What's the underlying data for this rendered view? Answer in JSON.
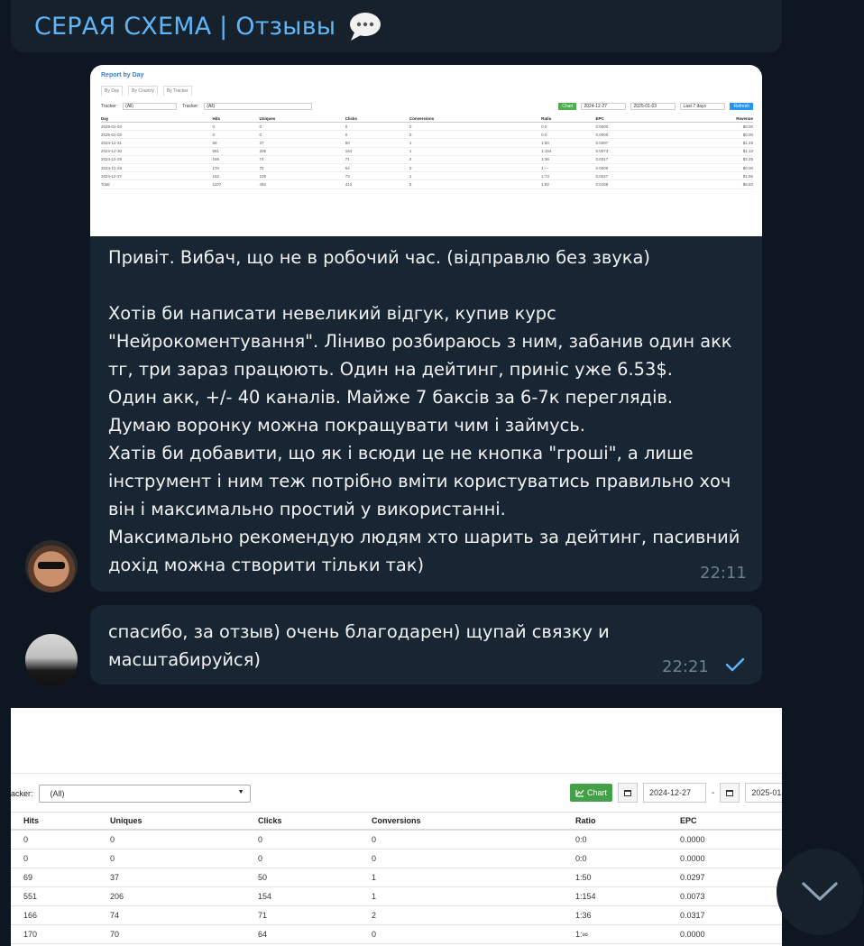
{
  "header": {
    "title": "СЕРАЯ СХЕМА | Отзывы",
    "title_icon": "speech-bubble-icon"
  },
  "report_thumb": {
    "title": "Report by Day",
    "tabs": [
      "By Day",
      "By Country",
      "By Tracker"
    ],
    "filter_label": "Tracker:",
    "filter_value": "(All)",
    "filter2_label": "Tracker:",
    "filter2_value": "(All)",
    "chart_label": "Chart",
    "date_from": "2024-12-27",
    "date_to": "2025-01-03",
    "range": "Last 7 days",
    "refresh_label": "Refresh",
    "columns": [
      "Day",
      "Hits",
      "Uniques",
      "Clicks",
      "Conversions",
      "Ratio",
      "EPC",
      "Revenue"
    ],
    "rows": [
      [
        "2025-01-03",
        "0",
        "0",
        "0",
        "0",
        "0.0",
        "0.0000",
        "$0.00"
      ],
      [
        "2025-01-02",
        "0",
        "0",
        "0",
        "0",
        "0.0",
        "0.0000",
        "$0.00"
      ],
      [
        "2024-12-31",
        "69",
        "37",
        "50",
        "1",
        "1:50",
        "0.0297",
        "$1.49"
      ],
      [
        "2024-12-30",
        "551",
        "206",
        "154",
        "1",
        "1:154",
        "0.0073",
        "$1.13"
      ],
      [
        "2024-12-29",
        "166",
        "74",
        "71",
        "2",
        "1:36",
        "0.0317",
        "$2.25"
      ],
      [
        "2024-12-28",
        "170",
        "70",
        "64",
        "0",
        "1:—",
        "0.0000",
        "$0.00"
      ],
      [
        "2024-12-27",
        "152",
        "105",
        "73",
        "1",
        "1:73",
        "0.0227",
        "$1.66"
      ],
      [
        "Total",
        "1107",
        "492",
        "412",
        "5",
        "1:82",
        "0.0158",
        "$6.53"
      ]
    ]
  },
  "message1": {
    "text": "Привіт. Вибач, що не в робочий час. (відправлю без звука)\n\nХотів би написати невеликий відгук, купив курс \"Нейрокоментування\". Ліниво розбираюсь з ним, забанив один акк тг, три зараз працюють. Один на дейтинг, приніс уже 6.53$.\nОдин акк, +/- 40 каналів. Майже 7 баксів за 6-7к переглядів.\nДумаю воронку можна покращувати чим і займусь.\nХатів би добавити, що як і всюди це не кнопка \"гроші\", а лише інструмент і ним теж потрібно вміти користуватись правильно хоч він і максимально простий у використанні.\nМаксимально рекомендую людям хто шарить за дейтинг, пасивний дохід можна створити тільки так)",
    "time": "22:11"
  },
  "message2": {
    "text": "спасибо, за отзыв) очень благодарен) щупай связку и масштабируйся)",
    "time": "22:21"
  },
  "bottom_report": {
    "filter_label": "acker:",
    "filter_value": "(All)",
    "chart_label": "Chart",
    "date_from": "2024-12-27",
    "date_to": "2025-01-",
    "date_sep": "-",
    "columns": [
      "Hits",
      "Uniques",
      "Clicks",
      "Conversions",
      "Ratio",
      "EPC"
    ],
    "rows": [
      [
        "0",
        "0",
        "0",
        "0",
        "0:0",
        "0.0000"
      ],
      [
        "0",
        "0",
        "0",
        "0",
        "0:0",
        "0.0000"
      ],
      [
        "69",
        "37",
        "50",
        "1",
        "1:50",
        "0.0297"
      ],
      [
        "551",
        "206",
        "154",
        "1",
        "1:154",
        "0.0073"
      ],
      [
        "166",
        "74",
        "71",
        "2",
        "1:36",
        "0.0317"
      ],
      [
        "170",
        "70",
        "64",
        "0",
        "1:∞",
        "0.0000"
      ]
    ]
  },
  "colors": {
    "accent": "#5eb5f7",
    "bubble": "#182533",
    "background": "#0e1621",
    "time": "#6d7f8f"
  }
}
